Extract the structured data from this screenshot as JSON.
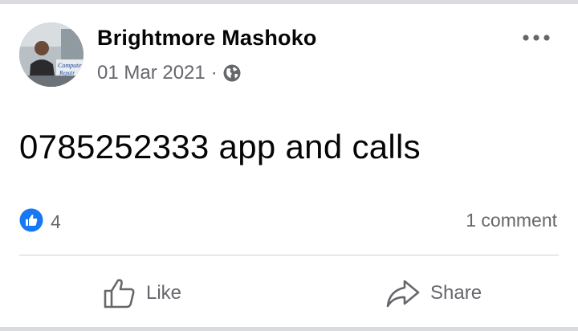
{
  "post": {
    "author": "Brightmore Mashoko",
    "date": "01 Mar 2021",
    "separator": "·",
    "privacy_icon": "globe-icon",
    "menu_icon": "more-horizontal-icon",
    "text": "0785252333 app and calls",
    "avatar_sign_text": "Computer Repair"
  },
  "stats": {
    "reaction_icon": "like-badge-icon",
    "reactions_count": "4",
    "comments_label": "1 comment"
  },
  "actions": {
    "like_label": "Like",
    "like_icon": "thumbs-up-outline-icon",
    "share_label": "Share",
    "share_icon": "share-arrow-icon"
  },
  "colors": {
    "background": "#d9dbdf",
    "card": "#ffffff",
    "primary_text": "#050505",
    "secondary_text": "#65676b",
    "like_blue": "#1877f2",
    "divider": "#ced0d4"
  }
}
